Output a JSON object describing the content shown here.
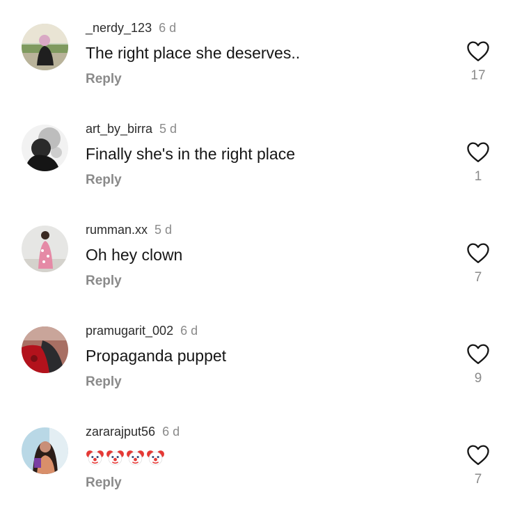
{
  "comments": [
    {
      "username": "_nerdy_123",
      "time": "6 d",
      "text": "The right place she deserves..",
      "reply_label": "Reply",
      "likes": "17",
      "avatar_icon": "profile-photo",
      "like_icon": "heart-outline-icon"
    },
    {
      "username": "art_by_birra",
      "time": "5 d",
      "text": "Finally she's in the right place",
      "reply_label": "Reply",
      "likes": "1",
      "avatar_icon": "profile-photo",
      "like_icon": "heart-outline-icon"
    },
    {
      "username": "rumman.xx",
      "time": "5 d",
      "text": "Oh hey clown",
      "reply_label": "Reply",
      "likes": "7",
      "avatar_icon": "profile-photo",
      "like_icon": "heart-outline-icon"
    },
    {
      "username": "pramugarit_002",
      "time": "6 d",
      "text": "Propaganda puppet",
      "reply_label": "Reply",
      "likes": "9",
      "avatar_icon": "profile-photo",
      "like_icon": "heart-outline-icon"
    },
    {
      "username": "zararajput56",
      "time": "6 d",
      "text": "🤡🤡🤡🤡",
      "reply_label": "Reply",
      "likes": "7",
      "avatar_icon": "profile-photo",
      "like_icon": "heart-outline-icon",
      "emoji": "clown-face-emoji",
      "emoji_count": 4
    }
  ],
  "colors": {
    "primary_text": "#161616",
    "username": "#2b2b2b",
    "secondary_text": "#8a8a8a",
    "background": "#ffffff"
  }
}
